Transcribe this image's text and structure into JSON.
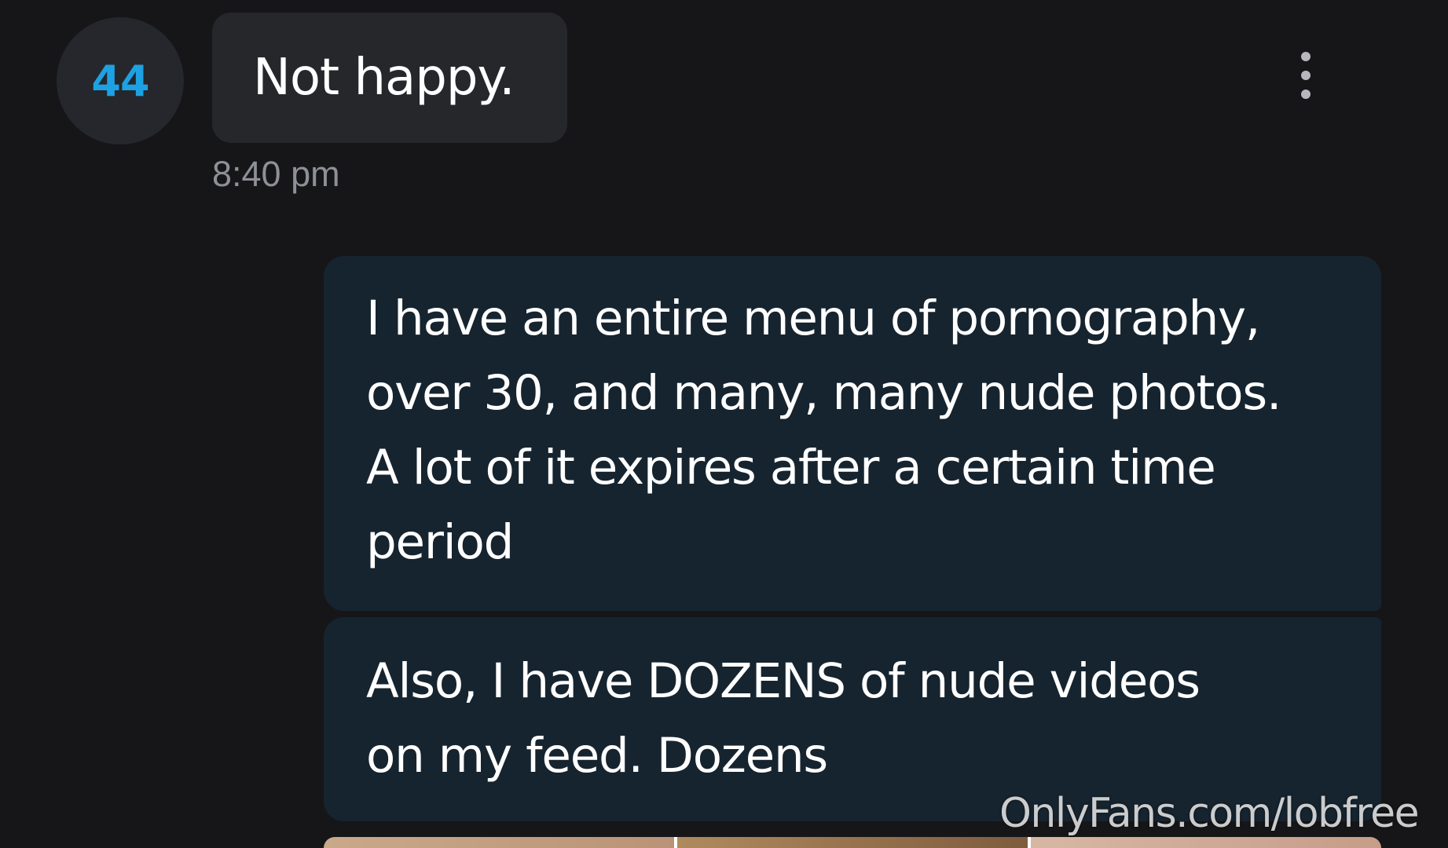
{
  "incoming_message": {
    "avatar_text": "44",
    "text": "Not happy.",
    "time": "8:40 pm"
  },
  "outgoing_messages": [
    {
      "lines": [
        "I have an entire menu of pornography,",
        "over 30, and many, many nude photos.",
        "A lot of it expires after a certain time",
        "period"
      ]
    },
    {
      "lines": [
        "Also, I have DOZENS of nude videos",
        "on my feed. Dozens"
      ]
    }
  ],
  "watermark": "OnlyFans.com/lobfree",
  "icons": {
    "more_options": "more-vertical-icon"
  },
  "colors": {
    "background": "#161619",
    "incoming_bubble": "#26272b",
    "outgoing_bubble": "#16242f",
    "avatar_text": "#1da1e2",
    "timestamp": "#8d9096"
  }
}
